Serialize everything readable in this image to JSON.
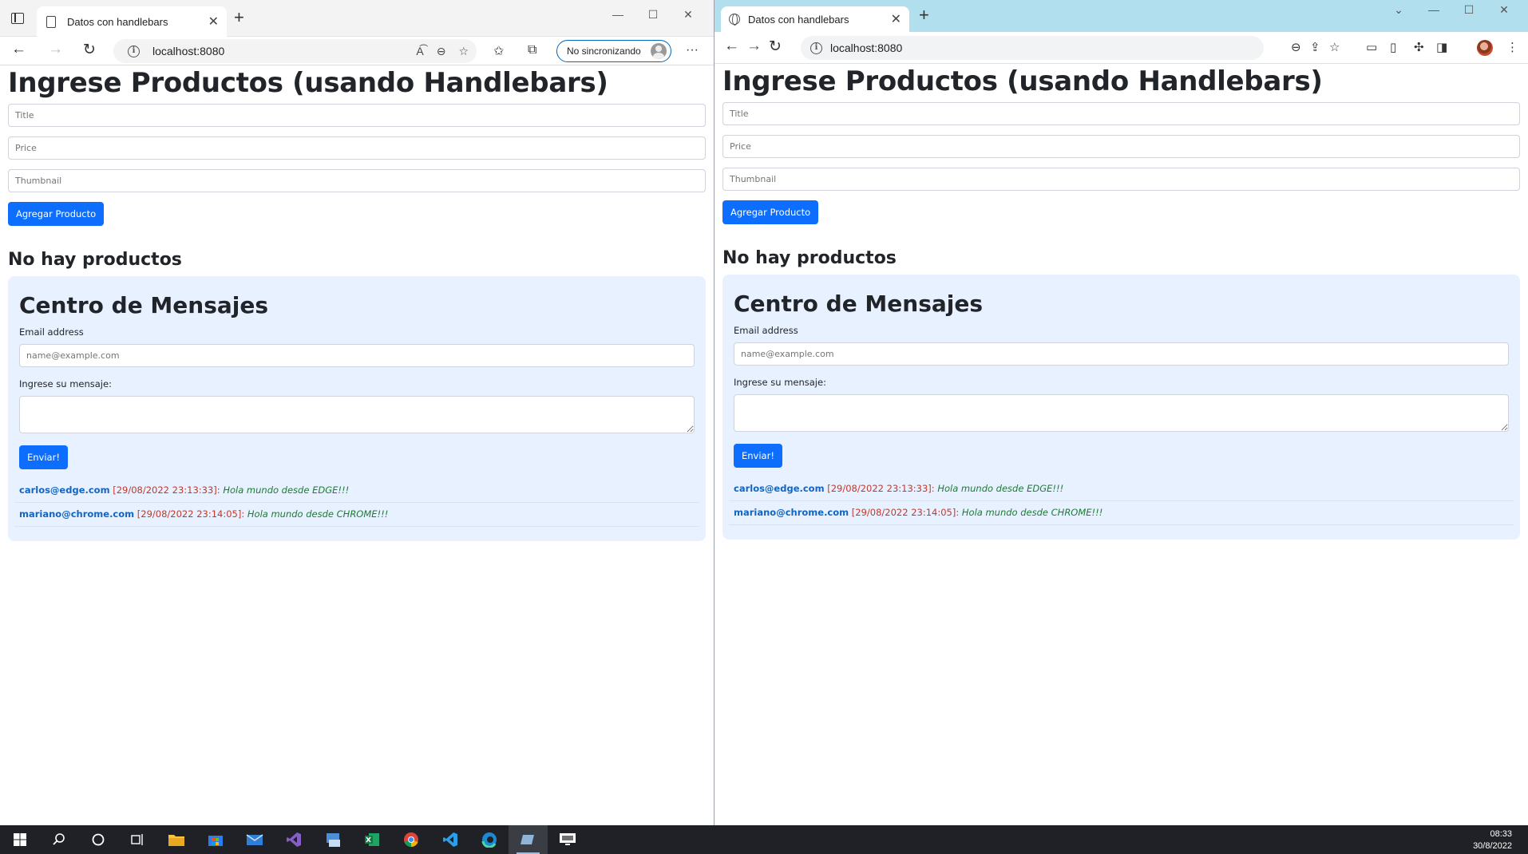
{
  "edge": {
    "tab_title": "Datos con handlebars",
    "url": "localhost:8080",
    "profile_label": "No sincronizando"
  },
  "chrome": {
    "tab_title": "Datos con handlebars",
    "url": "localhost:8080"
  },
  "page": {
    "title": "Ingrese Productos (usando Handlebars)",
    "title_placeholder": "Title",
    "price_placeholder": "Price",
    "thumbnail_placeholder": "Thumbnail",
    "add_button": "Agregar Producto",
    "no_products": "No hay productos",
    "messages": {
      "heading": "Centro de Mensajes",
      "email_label": "Email address",
      "email_placeholder": "name@example.com",
      "message_label": "Ingrese su mensaje:",
      "send_button": "Enviar!",
      "items": [
        {
          "email": "carlos@edge.com",
          "timestamp": "[29/08/2022 23:13:33]:",
          "text": "Hola mundo desde EDGE!!!"
        },
        {
          "email": "mariano@chrome.com",
          "timestamp": "[29/08/2022 23:14:05]:",
          "text": "Hola mundo desde CHROME!!!"
        }
      ]
    }
  },
  "taskbar": {
    "time": "08:33",
    "date": "30/8/2022"
  },
  "colors": {
    "primary": "#0d6efd",
    "message_box_bg": "#e7f1ff",
    "chrome_frame": "#b2dfee"
  }
}
